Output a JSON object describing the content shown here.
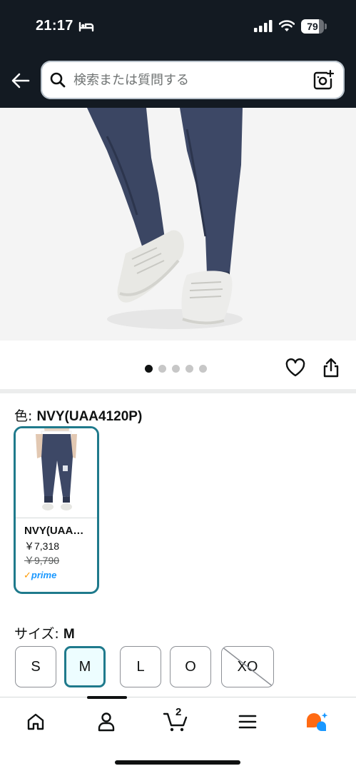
{
  "status_bar": {
    "time": "21:17",
    "battery_level": "79",
    "battery_fraction": 0.79
  },
  "header": {
    "search": {
      "placeholder": "検索または質問する"
    }
  },
  "product": {
    "image_index": 0,
    "image_count": 5
  },
  "color": {
    "label": "色: ",
    "selected_value": "NVY(UAA4120P)",
    "swatches": [
      {
        "name": "NVY(UAA…",
        "price": "￥7,318",
        "original_price": "￥9,790",
        "prime_label": "prime"
      }
    ]
  },
  "size": {
    "label": "サイズ: ",
    "selected_value": "M",
    "options": [
      {
        "label": "S",
        "state": "available"
      },
      {
        "label": "M",
        "state": "selected"
      },
      {
        "label": "L",
        "state": "available"
      },
      {
        "label": "O",
        "state": "available"
      },
      {
        "label": "XO",
        "state": "unavailable"
      }
    ]
  },
  "bottom_nav": {
    "items": [
      {
        "icon": "home-icon"
      },
      {
        "icon": "account-icon"
      },
      {
        "icon": "cart-icon",
        "count": "2"
      },
      {
        "icon": "menu-icon"
      },
      {
        "icon": "assistant-icon"
      }
    ]
  },
  "colors": {
    "header_bg": "#131a22",
    "accent_teal": "#1f7a8c",
    "prime_blue": "#1a98ff",
    "prime_check": "#ff9900",
    "assistant_orange": "#ff6a13",
    "assistant_blue": "#1a98ff"
  }
}
